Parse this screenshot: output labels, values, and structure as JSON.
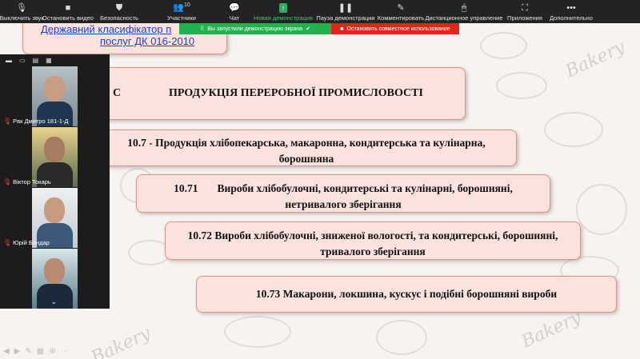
{
  "toolbar": {
    "items": [
      {
        "label": "Выключить звук",
        "icon": "microphone-icon"
      },
      {
        "label": "Остановить видео",
        "icon": "video-camera-icon"
      },
      {
        "label": "Безопасность",
        "icon": "shield-icon"
      },
      {
        "label": "Участники",
        "icon": "participants-icon",
        "count": "10"
      },
      {
        "label": "Чат",
        "icon": "chat-icon"
      },
      {
        "label": "Новая демонстрация",
        "icon": "share-screen-icon"
      },
      {
        "label": "Пауза демонстрации",
        "icon": "pause-icon"
      },
      {
        "label": "Комментировать",
        "icon": "annotate-icon"
      },
      {
        "label": "Дистанционное управление",
        "icon": "remote-control-icon"
      },
      {
        "label": "Приложения",
        "icon": "apps-icon"
      },
      {
        "label": "Дополнительно",
        "icon": "more-icon"
      }
    ],
    "accent_color": "#27ae60"
  },
  "share_banner": {
    "message": "Вы запустили демонстрацию экрана",
    "stop_label": "Остановить совместное использование",
    "green": "#22b14c",
    "red": "#e1251b"
  },
  "participants": [
    {
      "name": "Рак Дмитро 181-1-Д"
    },
    {
      "name": "Віктор Токарь"
    },
    {
      "name": "Юрій Бондар"
    },
    {
      "name": ""
    }
  ],
  "slide": {
    "top_link": "Державний класифікатор п",
    "top_link_line2": "послуг ДК 016-2010",
    "heading_letter": "С",
    "heading": "ПРОДУКЦІЯ ПЕРЕРОБНОЇ ПРОМИСЛОВОСТІ",
    "box1": "10.7 - Продукція хлібопекарська, макаронна, кондитерська та кулінарна, борошняна",
    "box2_code": "10.71",
    "box2_text": "Вироби хлібобулочні, кондитерські та кулінарні, борошняні, нетривалого зберігання",
    "box3": "10.72  Вироби хлібобулочні, зниженої вологості, та кондитерські, борошняні, тривалого зберігання",
    "box4": "10.73 Макарони, локшина, кускус і подібні борошняні вироби",
    "watermark": "Bakery"
  }
}
